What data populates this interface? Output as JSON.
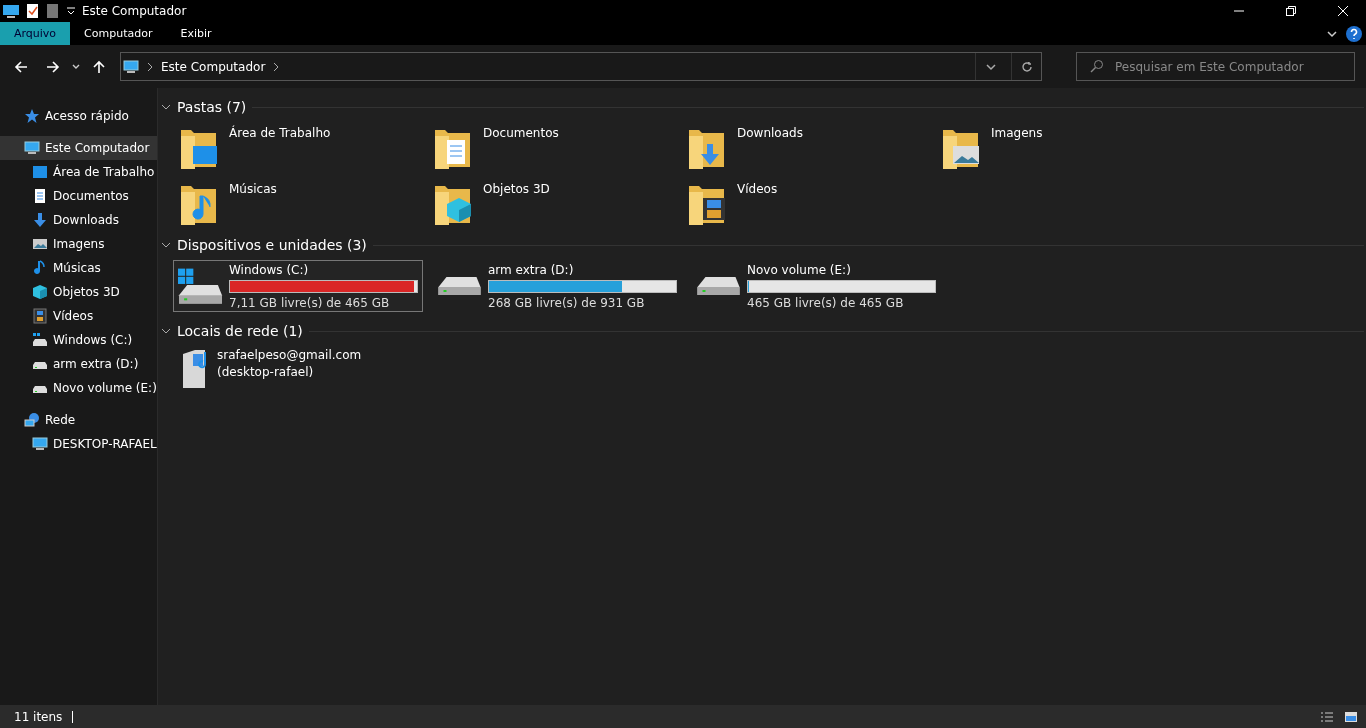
{
  "window": {
    "title": "Este Computador"
  },
  "ribbon_tabs": [
    {
      "label": "Arquivo",
      "selected": true
    },
    {
      "label": "Computador",
      "selected": false
    },
    {
      "label": "Exibir",
      "selected": false
    }
  ],
  "address": {
    "path": "Este Computador"
  },
  "search": {
    "placeholder": "Pesquisar em Este Computador"
  },
  "sidebar": {
    "items": [
      {
        "label": "Acesso rápido",
        "selected": false,
        "kind": "star"
      },
      {
        "label": "Este Computador",
        "selected": true,
        "kind": "pc",
        "children": [
          {
            "label": "Área de Trabalho",
            "selected": false,
            "kind": "desktop"
          },
          {
            "label": "Documentos",
            "selected": false,
            "kind": "doc"
          },
          {
            "label": "Downloads",
            "selected": false,
            "kind": "down"
          },
          {
            "label": "Imagens",
            "selected": false,
            "kind": "image"
          },
          {
            "label": "Músicas",
            "selected": false,
            "kind": "music"
          },
          {
            "label": "Objetos 3D",
            "selected": false,
            "kind": "cube"
          },
          {
            "label": "Vídeos",
            "selected": false,
            "kind": "film"
          },
          {
            "label": "Windows  (C:)",
            "selected": false,
            "kind": "windrive"
          },
          {
            "label": "arm extra (D:)",
            "selected": false,
            "kind": "drive"
          },
          {
            "label": "Novo volume (E:)",
            "selected": false,
            "kind": "drive"
          }
        ]
      },
      {
        "label": "Rede",
        "selected": false,
        "kind": "net",
        "children": [
          {
            "label": "DESKTOP-RAFAEL",
            "selected": false,
            "kind": "pc"
          }
        ]
      }
    ]
  },
  "folders": {
    "heading": "Pastas (7)",
    "items": [
      {
        "label": "Área de Trabalho",
        "kind": "desktop"
      },
      {
        "label": "Documentos",
        "kind": "doc"
      },
      {
        "label": "Downloads",
        "kind": "down"
      },
      {
        "label": "Imagens",
        "kind": "image"
      },
      {
        "label": "Músicas",
        "kind": "music"
      },
      {
        "label": "Objetos 3D",
        "kind": "cube"
      },
      {
        "label": "Vídeos",
        "kind": "film"
      }
    ]
  },
  "devices": {
    "heading": "Dispositivos e unidades (3)",
    "items": [
      {
        "label": "Windows  (C:)",
        "level": 0.985,
        "free": "7,11 GB livre(s) de 465 GB",
        "critical": true,
        "selected": true,
        "kind": "windrive"
      },
      {
        "label": "arm extra (D:)",
        "level": 0.712,
        "free": "268 GB livre(s) de 931 GB",
        "critical": false,
        "selected": false,
        "kind": "drive"
      },
      {
        "label": "Novo volume (E:)",
        "level": 0,
        "free": "465 GB livre(s) de 465 GB",
        "critical": false,
        "selected": false,
        "kind": "drive"
      }
    ]
  },
  "network": {
    "heading": "Locais de rede (1)",
    "items": [
      {
        "label": "srafaelpeso@gmail.com",
        "sublabel": "(desktop-rafael)"
      }
    ]
  },
  "status_bar": {
    "count": "11 itens"
  }
}
